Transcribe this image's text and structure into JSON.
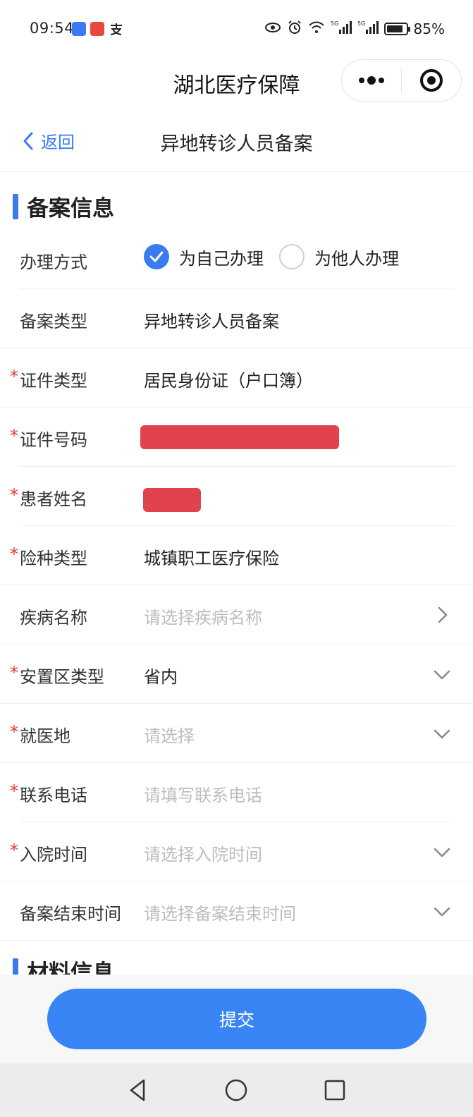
{
  "status_bar": {
    "time": "09:54",
    "battery": "85%",
    "battery_level": 0.85,
    "network_labels": [
      "5G",
      "5G"
    ]
  },
  "mini_program": {
    "title": "湖北医疗保障",
    "menu_icon": "more-dots-icon",
    "close_icon": "target-icon"
  },
  "nav": {
    "back_label": "返回",
    "title": "异地转诊人员备案"
  },
  "section_record": {
    "title": "备案信息"
  },
  "form": {
    "handling_method": {
      "label": "办理方式",
      "options": [
        "为自己办理",
        "为他人办理"
      ],
      "selected": "为自己办理"
    },
    "record_type": {
      "label": "备案类型",
      "value": "异地转诊人员备案"
    },
    "id_type": {
      "label": "证件类型",
      "required": "*",
      "value": "居民身份证（户口簿）"
    },
    "id_number": {
      "label": "证件号码",
      "required": "*"
    },
    "patient_name": {
      "label": "患者姓名",
      "required": "*"
    },
    "insurance_type": {
      "label": "险种类型",
      "required": "*",
      "value": "城镇职工医疗保险"
    },
    "disease_name": {
      "label": "疾病名称",
      "placeholder": "请选择疾病名称"
    },
    "placement_type": {
      "label": "安置区类型",
      "required": "*",
      "value": "省内"
    },
    "treatment_place": {
      "label": "就医地",
      "required": "*",
      "placeholder": "请选择"
    },
    "phone": {
      "label": "联系电话",
      "required": "*",
      "placeholder": "请填写联系电话"
    },
    "admission_time": {
      "label": "入院时间",
      "required": "*",
      "placeholder": "请选择入院时间"
    },
    "record_end_time": {
      "label": "备案结束时间",
      "placeholder": "请选择备案结束时间"
    }
  },
  "section_material": {
    "title": "材料信息"
  },
  "submit_label": "提交",
  "colors": {
    "accent": "#3a7bf0",
    "button": "#3a85f5",
    "required": "#e53935",
    "redaction": "#e1434e",
    "placeholder": "#bdbdbd"
  }
}
